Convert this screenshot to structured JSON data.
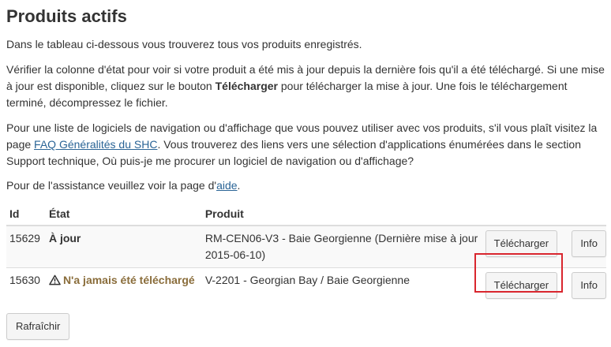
{
  "page": {
    "title": "Produits actifs"
  },
  "intro": {
    "p1": "Dans le tableau ci-dessous vous trouverez tous vos produits enregistrés.",
    "p2_before": "Vérifier la colonne d'état pour voir si votre produit a été mis à jour depuis la dernière fois qu'il a été téléchargé. Si une mise à jour est disponible, cliquez sur le bouton ",
    "p2_bold": "Télécharger",
    "p2_after": " pour télécharger la mise à jour. Une fois le téléchargement terminé, décompressez le fichier.",
    "p3_before": "Pour une liste de logiciels de navigation ou d'affichage que vous pouvez utiliser avec vos produits, s'il vous plaît visitez la page ",
    "p3_link": "FAQ Généralités du SHC",
    "p3_after": ". Vous trouverez des liens vers une sélection d'applications énumérées dans le section Support technique, Où puis-je me procurer un logiciel de navigation ou d'affichage?",
    "p4_before": "Pour de l'assistance veuillez voir la page d'",
    "p4_link": "aide",
    "p4_after": "."
  },
  "table": {
    "headers": {
      "id": "Id",
      "state": "État",
      "product": "Produit"
    },
    "rows": [
      {
        "id": "15629",
        "state": "À jour",
        "product": "RM-CEN06-V3 - Baie Georgienne (Dernière mise à jour 2015-06-10)",
        "download_label": "Télécharger",
        "info_label": "Info"
      },
      {
        "id": "15630",
        "state": "N'a jamais été téléchargé",
        "product": "V-2201 - Georgian Bay / Baie Georgienne",
        "download_label": "Télécharger",
        "info_label": "Info"
      }
    ]
  },
  "actions": {
    "refresh_label": "Rafraîchir"
  },
  "icons": {
    "warning": "warning-triangle-icon"
  },
  "colors": {
    "warning_text": "#8a6d3b",
    "link": "#2a6496",
    "highlight": "#d9262e"
  }
}
